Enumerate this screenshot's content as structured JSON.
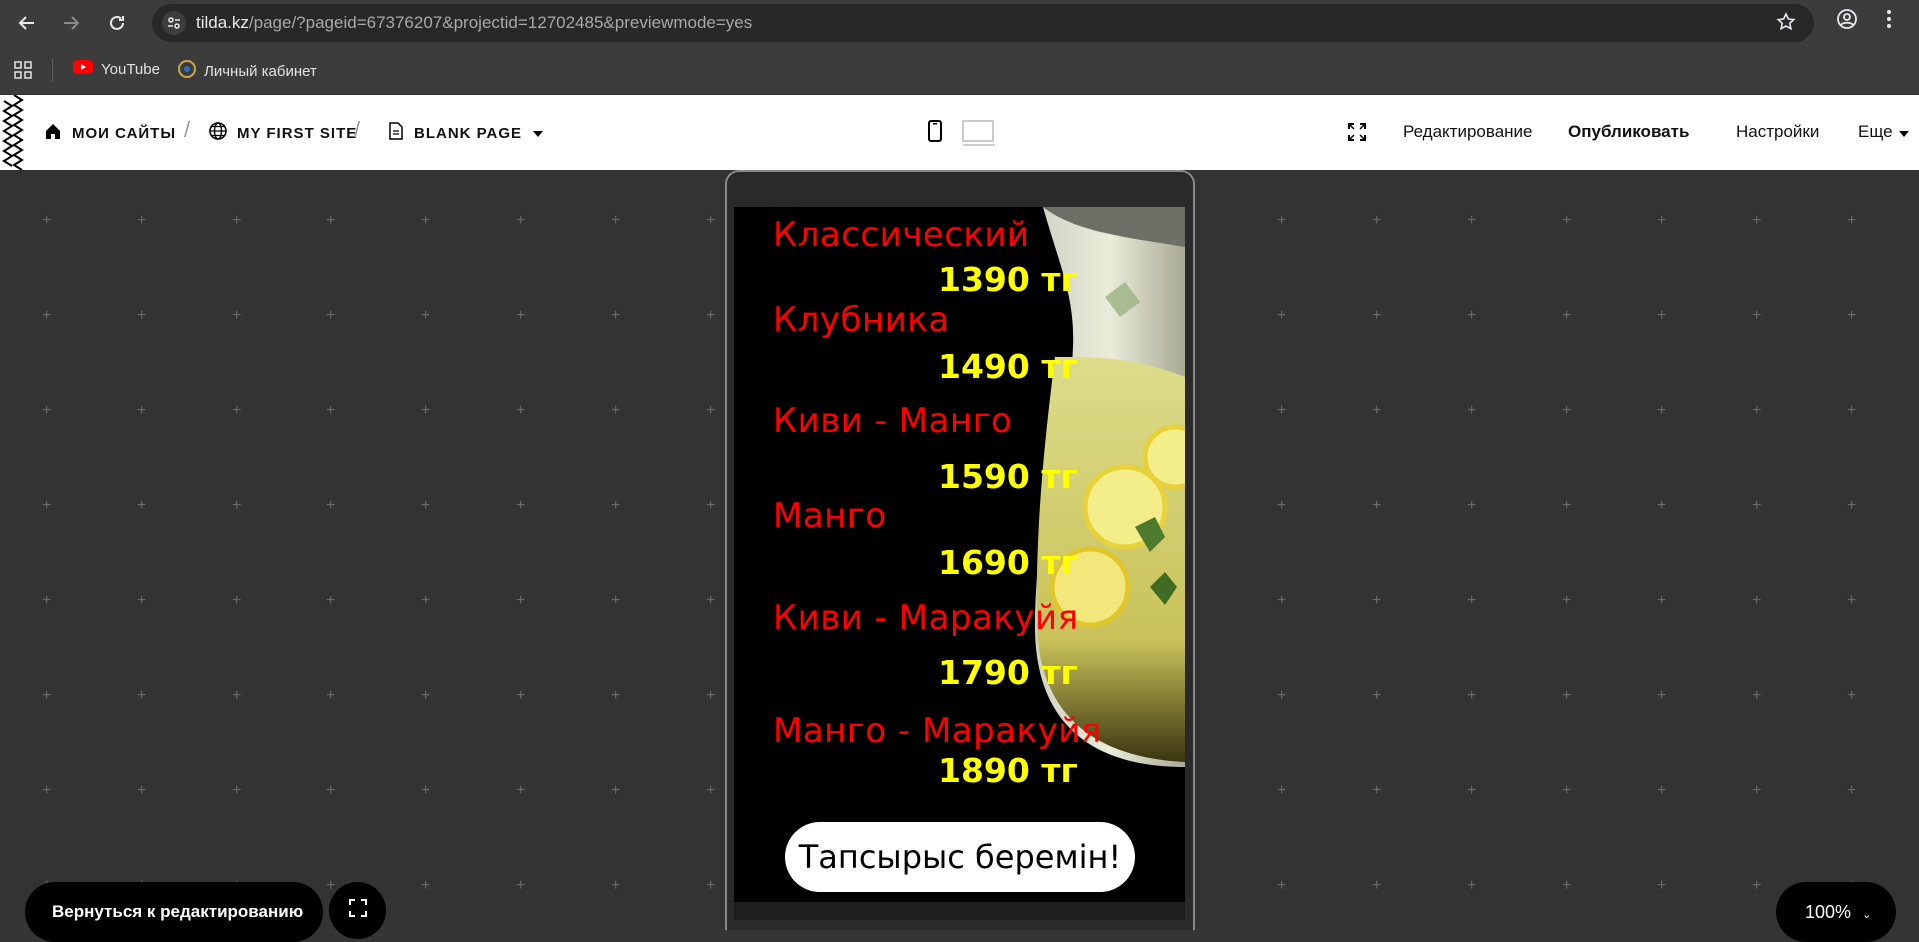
{
  "browser": {
    "url_host": "tilda.kz",
    "url_path": "/page/?pageid=67376207&projectid=12702485&previewmode=yes"
  },
  "bookmarks": [
    {
      "label": "YouTube",
      "icon": "youtube-icon"
    },
    {
      "label": "Личный кабинет",
      "icon": "cabinet-icon"
    }
  ],
  "tilda": {
    "crumbs": [
      "МОИ САЙТЫ",
      "MY FIRST SITE",
      "BLANK PAGE"
    ],
    "links": {
      "edit": "Редактирование",
      "publish": "Опубликовать",
      "settings": "Настройки",
      "more": "Еще"
    }
  },
  "menu": {
    "items": [
      {
        "name": "Классический",
        "price": "1390 тг"
      },
      {
        "name": "Клубника",
        "price": "1490 тг"
      },
      {
        "name": "Киви - Манго",
        "price": "1590 тг"
      },
      {
        "name": "Манго",
        "price": "1690 тг"
      },
      {
        "name": "Киви - Маракуйя",
        "price": "1790 тг"
      },
      {
        "name": "Манго - Маракуйя",
        "price": "1890 тг"
      }
    ],
    "order_button": "Тапсырыс беремін!"
  },
  "controls": {
    "back_to_edit": "Вернуться к редактированию",
    "zoom": "100%"
  },
  "colors": {
    "flavor": "#ff0000",
    "price": "#ffff00",
    "canvas": "#333333"
  }
}
